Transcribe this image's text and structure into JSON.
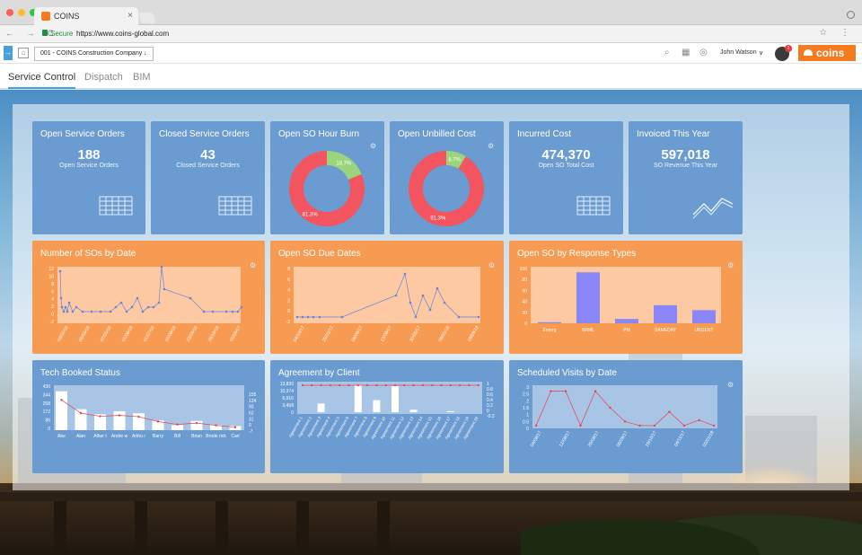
{
  "browser": {
    "tab_title": "COINS",
    "close_glyph": "×",
    "secure_label": "Secure",
    "url": "https://www.coins-global.com",
    "nav_glyphs": "← → C",
    "tool_glyphs": "☆ ⋮"
  },
  "header": {
    "company": "001 - COINS Construction Company ↓",
    "user_name": "John Watson",
    "user_caret": "∨",
    "notification_count": "1",
    "brand": "coins",
    "icons": [
      "search-icon",
      "grid-icon",
      "globe-icon"
    ]
  },
  "subnav": {
    "tabs": [
      "Service Control",
      "Dispatch",
      "BIM"
    ],
    "active": "Service Control"
  },
  "colors": {
    "blue_tile": "#6a9bd1",
    "orange_tile": "#f79a52",
    "pie_red": "#f2555f",
    "pie_green": "#9bd47a",
    "bar_purple": "#8a86f7",
    "line_point": "#6a82dd",
    "line_red": "#e8404a"
  },
  "kpis": [
    {
      "title": "Open Service Orders",
      "value": "188",
      "subtitle": "Open Service Orders",
      "icon": "table-icon"
    },
    {
      "title": "Closed Service Orders",
      "value": "43",
      "subtitle": "Closed Service Orders",
      "icon": "table-icon"
    },
    {
      "title": "Incurred Cost",
      "value": "474,370",
      "subtitle": "Open SO Total Cost",
      "icon": "table-icon"
    },
    {
      "title": "Invoiced This Year",
      "value": "597,018",
      "subtitle": "SO Revenue This Year",
      "icon": "trend-icon"
    }
  ],
  "donuts": [
    {
      "title": "Open SO Hour Burn",
      "slices": [
        {
          "label": "18.7%",
          "value": 18.7,
          "color": "#9bd47a"
        },
        {
          "label": "81.3%",
          "value": 81.3,
          "color": "#f2555f"
        }
      ]
    },
    {
      "title": "Open Unbilled Cost",
      "slices": [
        {
          "label": "8.7%",
          "value": 8.7,
          "color": "#9bd47a"
        },
        {
          "label": "91.3%",
          "value": 91.3,
          "color": "#f2555f"
        }
      ]
    }
  ],
  "charts": {
    "sos_by_date": {
      "title": "Number of SOs by Date",
      "y_ticks": [
        "12",
        "10",
        "8",
        "6",
        "4",
        "2",
        "0",
        "-2"
      ],
      "x_labels": [
        "03/02/16",
        "06/03/16",
        "07/05/16",
        "01/06/16",
        "01/07/16",
        "16/08/16",
        "23/09/16",
        "28/10/16",
        "15/09/17"
      ]
    },
    "due_dates": {
      "title": "Open SO Due Dates",
      "y_ticks": [
        "8",
        "6",
        "4",
        "2",
        "0",
        "-2"
      ],
      "x_labels": [
        "04/10/17",
        "25/02/17",
        "08/09/17",
        "13/08/17",
        "30/05/17",
        "08/02/18",
        "18/09/18"
      ]
    },
    "response_types": {
      "title": "Open SO by Response Types",
      "y_ticks": [
        "100",
        "80",
        "60",
        "40",
        "20",
        "0"
      ],
      "categories": [
        "Emerg",
        "NRML",
        "PM",
        "SAMEDAY",
        "URGENT"
      ],
      "values": [
        2,
        93,
        8,
        33,
        24
      ]
    },
    "tech_booked": {
      "title": "Tech Booked Status",
      "y_ticks": [
        "430",
        "344",
        "258",
        "172",
        "86",
        "0"
      ],
      "y2_ticks": [
        "155",
        "124",
        "93",
        "62",
        "31",
        "0",
        "-7"
      ],
      "categories": [
        "Abe",
        "Alan",
        "Alber t",
        "Andre w",
        "Arthu r",
        "Barry",
        "Bill",
        "Brian",
        "Brode rick",
        "Carl"
      ],
      "bars": [
        380,
        205,
        155,
        185,
        165,
        95,
        50,
        90,
        50,
        40
      ],
      "line": [
        130,
        72,
        58,
        62,
        56,
        35,
        22,
        28,
        18,
        10
      ]
    },
    "agreement": {
      "title": "Agreement by Client",
      "y_ticks": [
        "13,830",
        "10,374",
        "6,916",
        "3,458",
        "0"
      ],
      "y2_ticks": [
        "1",
        "0.8",
        "0.6",
        "0.4",
        "0.2",
        "0",
        "-0.2"
      ],
      "categories": [
        "Agreement 1",
        "Agreement 2",
        "Agreement 3",
        "Agreement 4",
        "Agreement 5",
        "Agreement 6",
        "Agreement 7",
        "Agreement 8",
        "Agreement 9",
        "Agreement 10",
        "Agreement 11",
        "Agreement 12",
        "Agreement 13",
        "Agreement 14",
        "Agreement 15",
        "Agreement 16",
        "Agreement 17",
        "Agreement 18",
        "Agreement 19",
        "Agreement 20"
      ],
      "values": [
        0,
        0,
        4200,
        0,
        0,
        0,
        12900,
        0,
        5800,
        0,
        12500,
        0,
        1200,
        0,
        0,
        0,
        500,
        0,
        0,
        0
      ],
      "line": [
        1,
        1,
        1,
        1,
        1,
        1,
        1,
        1,
        1,
        1,
        1,
        1,
        1,
        1,
        1,
        1,
        1,
        1,
        1,
        1
      ]
    },
    "scheduled_visits": {
      "title": "Scheduled Visits by Date",
      "y_ticks": [
        "3",
        "2.5",
        "2",
        "1.5",
        "1",
        "0.5",
        "0"
      ],
      "x_labels": [
        "04/08/17",
        "12/08/17",
        "26/08/17",
        "06/09/17",
        "19/10/17",
        "04/11/17",
        "03/01/18"
      ],
      "line": [
        0.2,
        2.7,
        2.7,
        0.2,
        2.7,
        1.5,
        0.5,
        0.2,
        0.2,
        1.2,
        0.2,
        0.6,
        0.2
      ]
    }
  },
  "chart_data": [
    {
      "type": "bar",
      "title": "Open SO by Response Types",
      "categories": [
        "Emerg",
        "NRML",
        "PM",
        "SAMEDAY",
        "URGENT"
      ],
      "values": [
        2,
        93,
        8,
        33,
        24
      ],
      "ylim": [
        0,
        100
      ]
    },
    {
      "type": "bar",
      "title": "Tech Booked Status",
      "categories": [
        "Abe",
        "Alan",
        "Albert",
        "Andrew",
        "Arthur",
        "Barry",
        "Bill",
        "Brian",
        "Broderick",
        "Carl"
      ],
      "values": [
        380,
        205,
        155,
        185,
        165,
        95,
        50,
        90,
        50,
        40
      ],
      "ylim": [
        0,
        430
      ]
    },
    {
      "type": "pie",
      "title": "Open SO Hour Burn",
      "categories": [
        "18.7%",
        "81.3%"
      ],
      "values": [
        18.7,
        81.3
      ]
    },
    {
      "type": "pie",
      "title": "Open Unbilled Cost",
      "categories": [
        "8.7%",
        "91.3%"
      ],
      "values": [
        8.7,
        91.3
      ]
    }
  ]
}
